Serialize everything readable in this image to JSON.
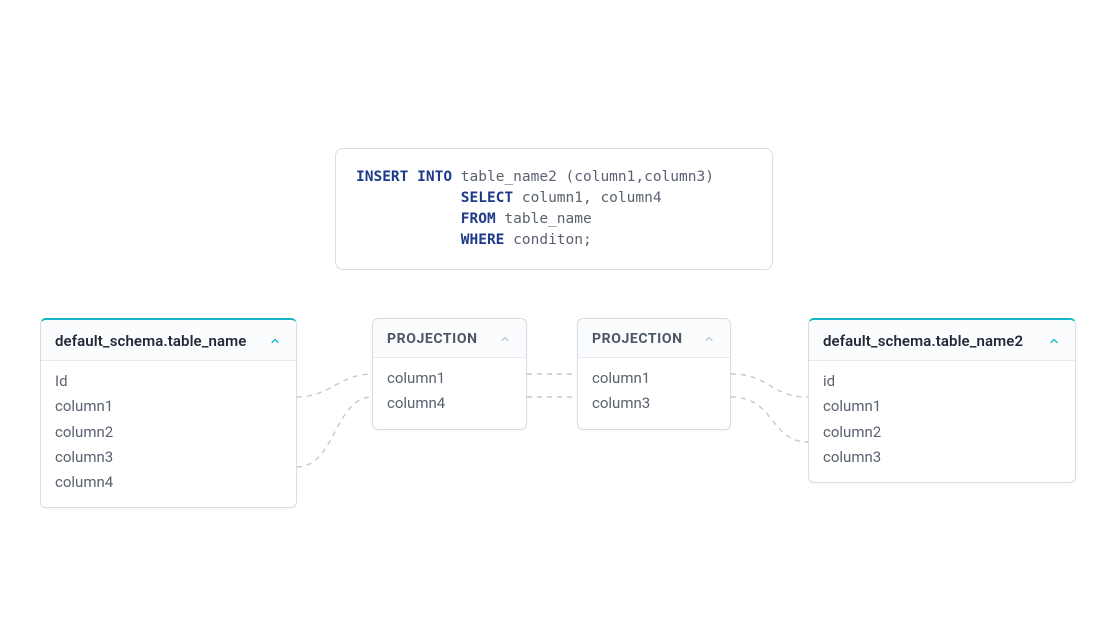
{
  "sql": {
    "tokens": [
      {
        "t": "INSERT",
        "kw": true
      },
      {
        "t": " "
      },
      {
        "t": "INTO",
        "kw": true
      },
      {
        "t": " table_name2 (column1,column3)"
      },
      {
        "t": "\n            "
      },
      {
        "t": "SELECT",
        "kw": true
      },
      {
        "t": " column1, column4"
      },
      {
        "t": "\n            "
      },
      {
        "t": "FROM",
        "kw": true
      },
      {
        "t": " table_name"
      },
      {
        "t": "\n            "
      },
      {
        "t": "WHERE",
        "kw": true
      },
      {
        "t": " conditon;"
      }
    ]
  },
  "nodes": {
    "source": {
      "title": "default_schema.table_name",
      "columns": [
        "Id",
        "column1",
        "column2",
        "column3",
        "column4"
      ]
    },
    "proj1": {
      "title": "PROJECTION",
      "columns": [
        "column1",
        "column4"
      ]
    },
    "proj2": {
      "title": "PROJECTION",
      "columns": [
        "column1",
        "column3"
      ]
    },
    "target": {
      "title": "default_schema.table_name2",
      "columns": [
        "id",
        "column1",
        "column2",
        "column3"
      ]
    }
  },
  "chevron_color_teal": "#14b8c4",
  "chevron_color_gray": "#9aa3af"
}
